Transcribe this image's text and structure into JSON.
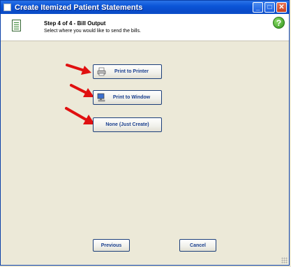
{
  "window": {
    "title": "Create Itemized Patient Statements",
    "minimize_glyph": "_",
    "maximize_glyph": "□",
    "close_glyph": "✕"
  },
  "header": {
    "step_title": "Step 4 of 4 - Bill Output",
    "step_subtitle": "Select where you would like to send the bills.",
    "help_glyph": "?",
    "icons": {
      "step": "document-icon",
      "help": "help-icon"
    }
  },
  "options": {
    "print_to_printer": {
      "label": "Print to Printer",
      "icon": "printer-icon"
    },
    "print_to_window": {
      "label": "Print to Window",
      "icon": "monitor-icon"
    },
    "none": {
      "label": "None (Just Create)"
    }
  },
  "footer": {
    "previous_label": "Previous",
    "cancel_label": "Cancel"
  },
  "colors": {
    "titlebar": "#0b55d8",
    "annotation_arrow": "#e01010",
    "button_text": "#1a3f8f"
  }
}
